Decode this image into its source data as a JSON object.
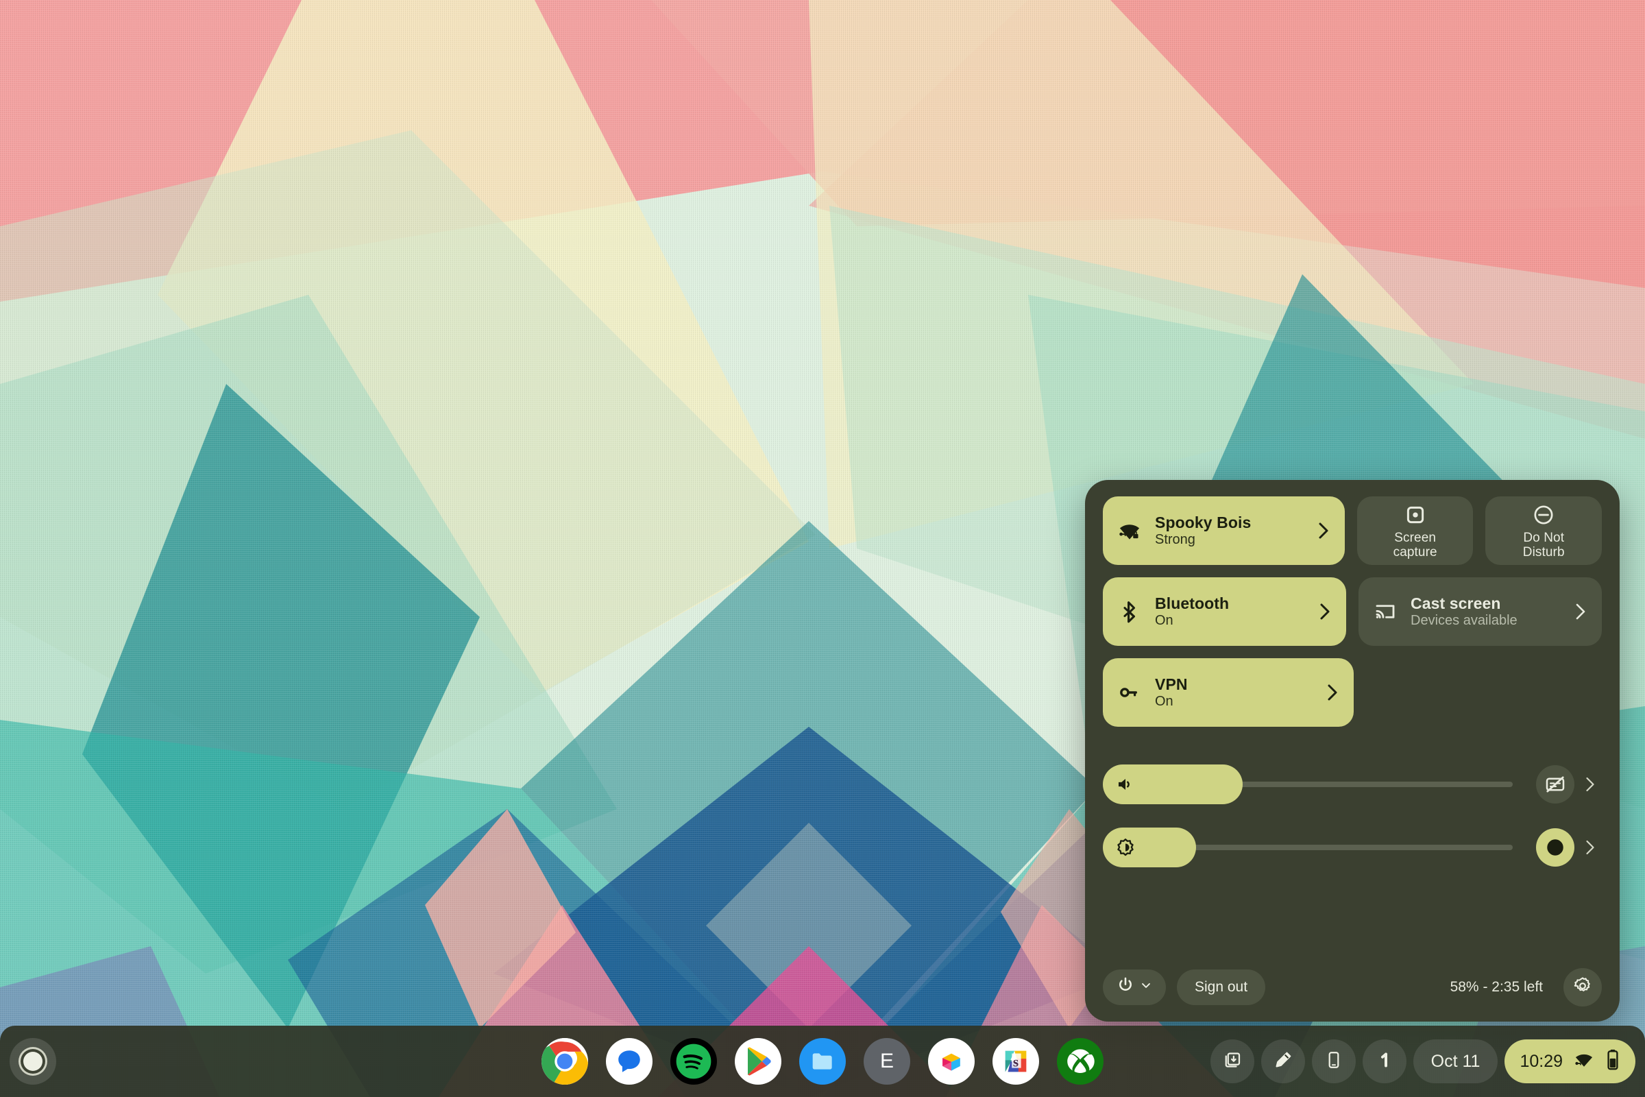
{
  "colors": {
    "panel_bg": "#3b4030",
    "tile_active": "#cfd484",
    "tile_inactive": "#4d5341",
    "accent_text_dark": "#1b1f10",
    "shelf_bg": "#2f3426"
  },
  "quick_settings": {
    "tiles": [
      {
        "name": "wifi",
        "icon": "wifi-lock-icon",
        "title": "Spooky Bois",
        "subtitle": "Strong",
        "state": "active",
        "chevron": true
      },
      {
        "name": "screen-capture",
        "icon": "screen-capture-icon",
        "title": "Screen\ncapture",
        "subtitle": "",
        "state": "inactive",
        "chevron": false
      },
      {
        "name": "do-not-disturb",
        "icon": "do-not-disturb-icon",
        "title": "Do Not\nDisturb",
        "subtitle": "",
        "state": "inactive",
        "chevron": false
      },
      {
        "name": "bluetooth",
        "icon": "bluetooth-icon",
        "title": "Bluetooth",
        "subtitle": "On",
        "state": "active",
        "chevron": true
      },
      {
        "name": "cast-screen",
        "icon": "cast-icon",
        "title": "Cast screen",
        "subtitle": "Devices available",
        "state": "inactive",
        "chevron": true
      },
      {
        "name": "vpn",
        "icon": "vpn-key-icon",
        "title": "VPN",
        "subtitle": "On",
        "state": "active",
        "chevron": true
      }
    ],
    "sliders": [
      {
        "name": "volume",
        "icon": "volume-icon",
        "fill_percent": 33,
        "side_icon": "captions-off-icon",
        "side_state": "inactive"
      },
      {
        "name": "brightness",
        "icon": "brightness-icon",
        "fill_percent": 22,
        "side_icon": "night-light-icon",
        "side_state": "active"
      }
    ],
    "bottom": {
      "power_icon": "power-icon",
      "power_chevron_icon": "chevron-down-icon",
      "sign_out_label": "Sign out",
      "battery_status": "58% - 2:35 left",
      "settings_icon": "gear-icon"
    }
  },
  "shelf": {
    "launcher": {
      "icon": "launcher-icon"
    },
    "apps": [
      {
        "name": "chrome",
        "label": "Chrome",
        "running": true
      },
      {
        "name": "messages",
        "label": "Messages",
        "running": false
      },
      {
        "name": "spotify",
        "label": "Spotify",
        "running": false
      },
      {
        "name": "play-store",
        "label": "Play Store",
        "running": false
      },
      {
        "name": "files",
        "label": "Files",
        "running": false
      },
      {
        "name": "explore",
        "label": "E",
        "running": false
      },
      {
        "name": "photos-box",
        "label": "Box",
        "running": false
      },
      {
        "name": "slack",
        "label": "Slack",
        "running": false
      },
      {
        "name": "xbox",
        "label": "Xbox",
        "running": false
      }
    ],
    "tray_buttons": [
      {
        "name": "screen-capture-tray",
        "icon": "capture-stack-icon"
      },
      {
        "name": "stylus-tray",
        "icon": "stylus-icon"
      },
      {
        "name": "phone-hub-tray",
        "icon": "phone-icon"
      },
      {
        "name": "notification-count",
        "icon": "badge-one-icon",
        "label": "1"
      }
    ],
    "date": "Oct 11",
    "status": {
      "time": "10:29",
      "wifi_icon": "wifi-vpn-icon",
      "battery_icon": "battery-icon"
    }
  }
}
